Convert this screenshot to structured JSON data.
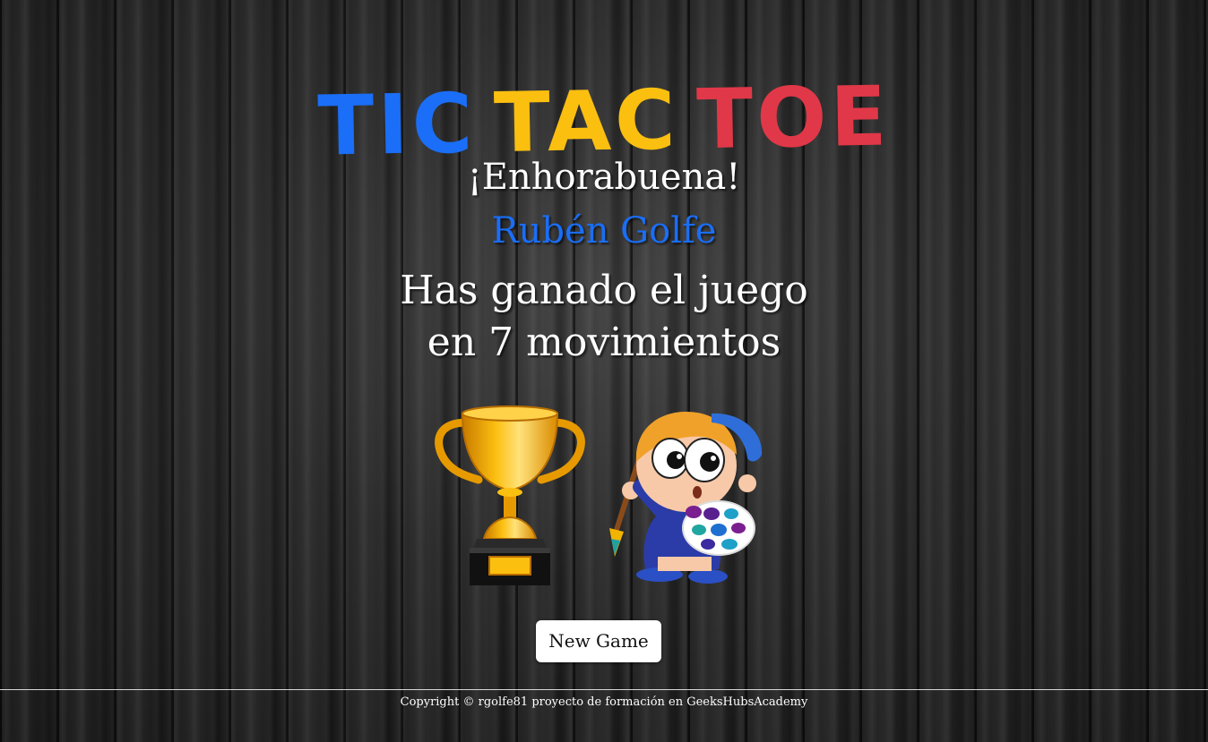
{
  "title": {
    "word1": "TIC",
    "word2": "TAC",
    "word3": "TOE"
  },
  "result": {
    "congrats": "¡Enhorabuena!",
    "player_name": "Rubén Golfe",
    "line1": "Has ganado el juego",
    "line2": "en 7 movimientos",
    "moves": 7
  },
  "images": {
    "trophy": "trophy-icon",
    "winner": "painter-kid-icon"
  },
  "buttons": {
    "new_game": "New Game"
  },
  "footer": {
    "copyright": "Copyright © rgolfe81 proyecto de formación en GeeksHubsAcademy"
  },
  "colors": {
    "blue": "#1a6ef7",
    "yellow": "#fbbf10",
    "red": "#e03848",
    "background": "#1c1c1c"
  }
}
